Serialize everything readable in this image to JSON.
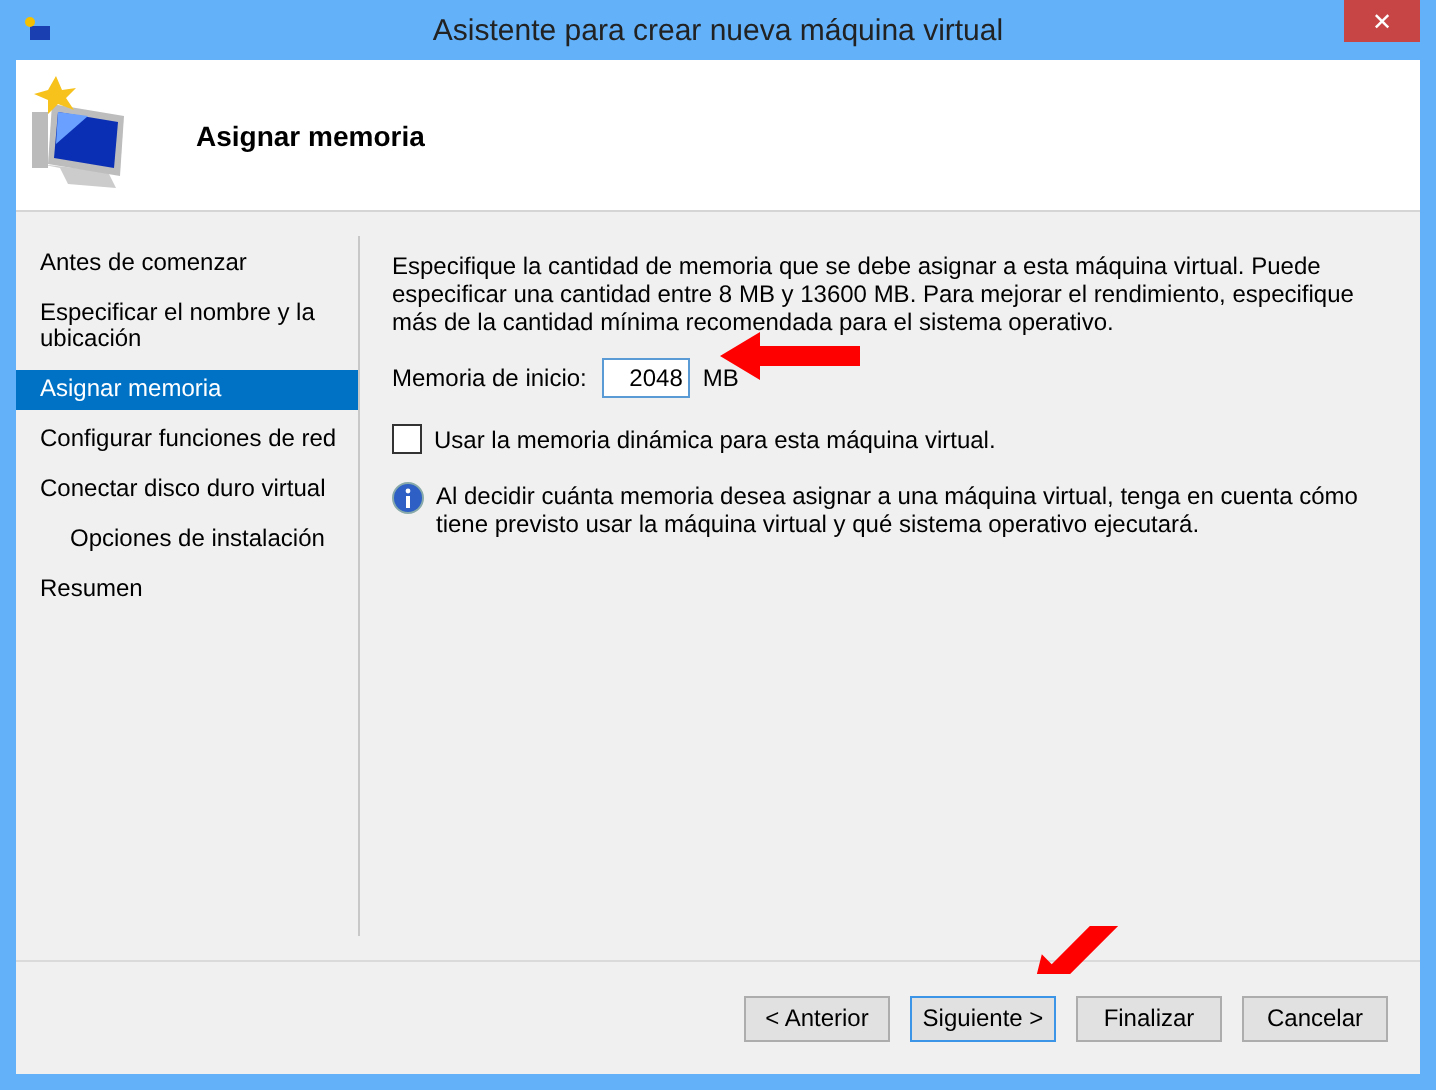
{
  "window": {
    "title": "Asistente para crear nueva máquina virtual",
    "close": "✕"
  },
  "header": {
    "title": "Asignar memoria"
  },
  "steps": [
    {
      "label": "Antes de comenzar",
      "selected": false
    },
    {
      "label": "Especificar el nombre y la ubicación",
      "selected": false
    },
    {
      "label": "Asignar memoria",
      "selected": true
    },
    {
      "label": "Configurar funciones de red",
      "selected": false
    },
    {
      "label": "Conectar disco duro virtual",
      "selected": false,
      "children": [
        {
          "label": "Opciones de instalación",
          "selected": false
        }
      ]
    },
    {
      "label": "Resumen",
      "selected": false
    }
  ],
  "description": "Especifique la cantidad de memoria que se debe asignar a esta máquina virtual. Puede especificar una cantidad entre 8 MB y 13600 MB. Para mejorar el rendimiento, especifique más de la cantidad mínima recomendada para el sistema operativo.",
  "memory": {
    "label": "Memoria de inicio:",
    "value": "2048",
    "unit": "MB"
  },
  "dynamic_memory": {
    "label": "Usar la memoria dinámica para esta máquina virtual.",
    "checked": false
  },
  "info": "Al decidir cuánta memoria desea asignar a una máquina virtual, tenga en cuenta cómo tiene previsto usar la máquina virtual y qué sistema operativo ejecutará.",
  "buttons": [
    {
      "label": "< Anterior",
      "default": false
    },
    {
      "label": "Siguiente >",
      "default": true
    },
    {
      "label": "Finalizar",
      "default": false
    },
    {
      "label": "Cancelar",
      "default": false
    }
  ]
}
